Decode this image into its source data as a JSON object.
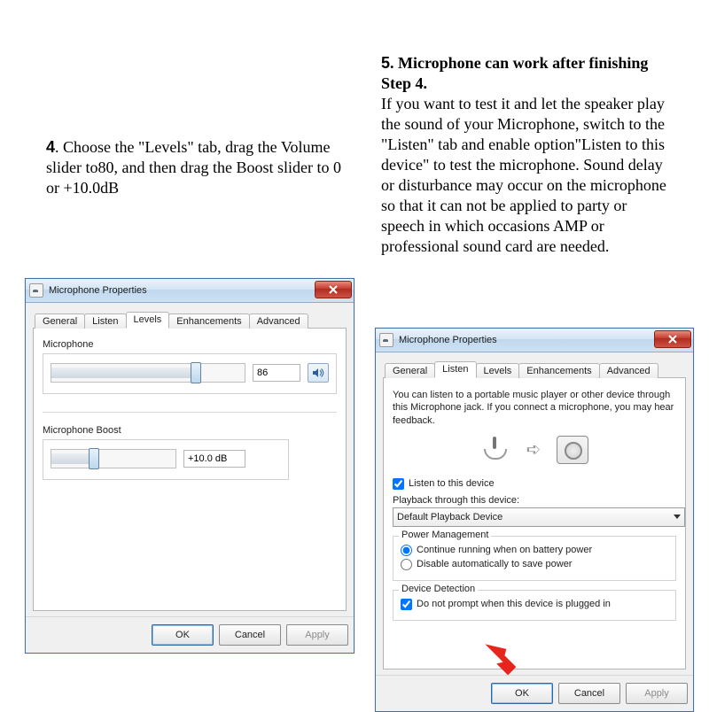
{
  "step4": {
    "number": "4",
    "text": ". Choose the \"Levels\" tab, drag the Volume slider to80, and then drag the Boost slider to 0 or +10.0dB"
  },
  "step5": {
    "number": "5",
    "title": ". Microphone can work after finishing Step 4.",
    "body": "If you want to test it and let the speaker play the sound of your Microphone, switch to the \"Listen\" tab and enable option\"Listen to this device\" to test the microphone. Sound delay or disturbance may occur on the microphone so that it can not be applied to party or speech in which occasions AMP or professional sound card are needed."
  },
  "winA": {
    "title": "Microphone Properties",
    "tabs": {
      "general": "General",
      "listen": "Listen",
      "levels": "Levels",
      "enhancements": "Enhancements",
      "advanced": "Advanced"
    },
    "mic_label": "Microphone",
    "mic_value": "86",
    "boost_label": "Microphone Boost",
    "boost_value": "+10.0 dB",
    "ok": "OK",
    "cancel": "Cancel",
    "apply": "Apply"
  },
  "winB": {
    "title": "Microphone Properties",
    "tabs": {
      "general": "General",
      "listen": "Listen",
      "levels": "Levels",
      "enhancements": "Enhancements",
      "advanced": "Advanced"
    },
    "desc": "You can listen to a portable music player or other device through this Microphone jack. If you connect a microphone, you may hear feedback.",
    "listen_chk": "Listen to this device",
    "playback_label": "Playback through this device:",
    "playback_value": "Default Playback Device",
    "pm_legend": "Power Management",
    "pm_opt1": "Continue running when on battery power",
    "pm_opt2": "Disable automatically to save power",
    "dd_legend": "Device Detection",
    "dd_chk": "Do not prompt when this device is plugged in",
    "ok": "OK",
    "cancel": "Cancel",
    "apply": "Apply"
  }
}
